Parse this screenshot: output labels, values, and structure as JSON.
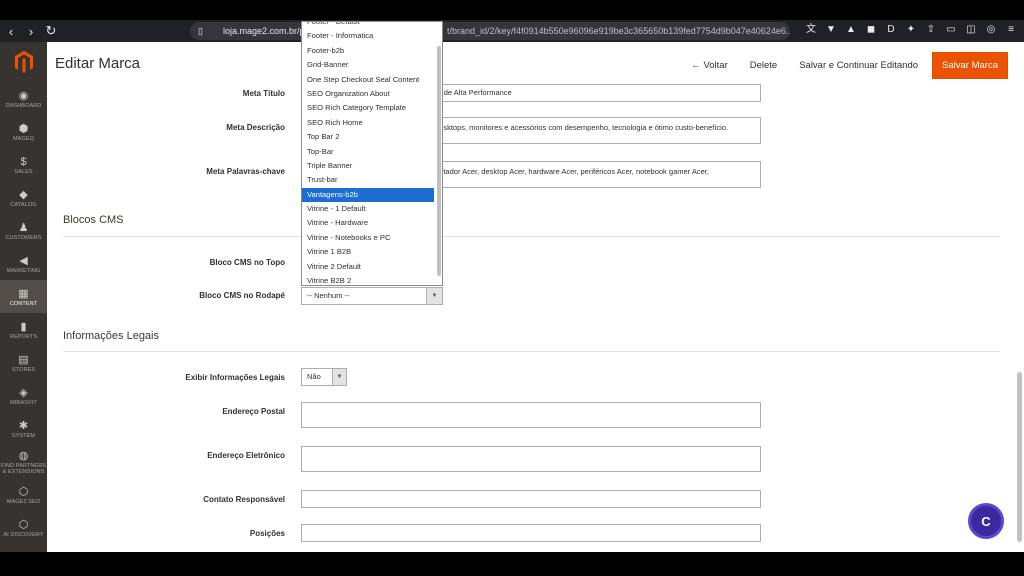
{
  "browser": {
    "url_domain": "loja.mage2.com.br/p",
    "url_rest": "t/brand_id/2/key/f4f0914b550e96096e919be3c365650b139fed7754d9b047e40624e6..."
  },
  "sidebar": {
    "items": [
      {
        "label": "DASHBOARD",
        "icon": "◉"
      },
      {
        "label": "MAGEQ",
        "icon": "⬢"
      },
      {
        "label": "SALES",
        "icon": "$"
      },
      {
        "label": "CATALOG",
        "icon": "◆"
      },
      {
        "label": "CUSTOMERS",
        "icon": "♟"
      },
      {
        "label": "MARKETING",
        "icon": "◀"
      },
      {
        "label": "CONTENT",
        "icon": "▦"
      },
      {
        "label": "REPORTS",
        "icon": "▮"
      },
      {
        "label": "STORES",
        "icon": "▤"
      },
      {
        "label": "MIRASVIT",
        "icon": "◈"
      },
      {
        "label": "SYSTEM",
        "icon": "✱"
      },
      {
        "label": "FIND PARTNERS & EXTENSIONS",
        "icon": "◍"
      },
      {
        "label": "MAGE2 SEO",
        "icon": "⬡"
      },
      {
        "label": "AI DISCOVERY",
        "icon": "⬡"
      }
    ]
  },
  "header": {
    "title": "Editar Marca",
    "back_label": "Voltar",
    "delete_label": "Delete",
    "save_continue_label": "Salvar e Continuar Editando",
    "save_label": "Salvar Marca"
  },
  "meta": {
    "title_label": "Meta Título",
    "title_value": "re de Alta Performance",
    "description_label": "Meta Descrição",
    "description_value": "desktops, monitores e acessórios com desempenho, tecnologia e ótimo custo-benefício.",
    "keywords_label": "Meta Palavras-chave",
    "keywords_value": "putador Acer, desktop Acer, hardware Acer, periféricos Acer, notebook gamer Acer,"
  },
  "cms": {
    "section_title": "Blocos CMS",
    "top_label": "Bloco CMS no Topo",
    "bottom_label": "Bloco CMS no Rodapé",
    "bottom_value": "-- Nenhum --"
  },
  "dropdown": {
    "items": [
      "Footer - Default",
      "Footer - Informatica",
      "Footer-b2b",
      "Grid-Banner",
      "One Step Checkout Seal Content",
      "SEO Organization About",
      "SEO Rich Category Template",
      "SEO Rich Home",
      "Top Bar 2",
      "Top-Bar",
      "Triple Banner",
      "Trust-bar",
      "Vantagens-b2b",
      "Vitrine - 1 Default",
      "Vitrine - Hardware",
      "Vitrine - Notebooks e PC",
      "Vitrine 1 B2B",
      "Vitrine 2 Default",
      "Vitrine B2B 2"
    ],
    "selected_index": 12
  },
  "legal": {
    "section_title": "Informações Legais",
    "show_label": "Exibir Informações Legais",
    "show_value": "Não",
    "address_label": "Endereço Postal",
    "email_label": "Endereço Eletrônico",
    "contact_label": "Contato Responsável",
    "positions_label": "Posições"
  },
  "chat": {
    "label": "C"
  }
}
